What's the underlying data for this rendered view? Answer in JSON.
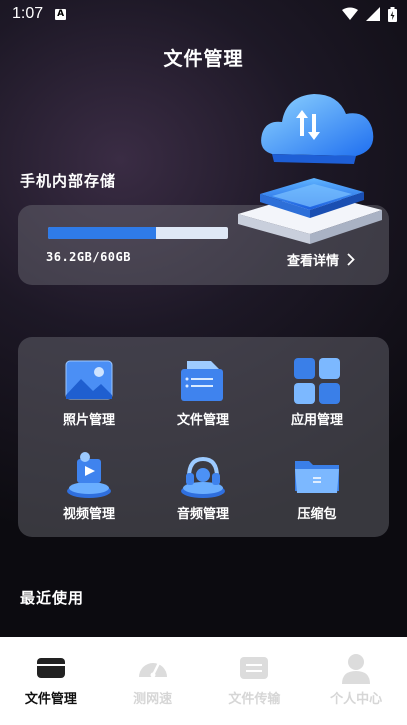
{
  "status": {
    "time": "1:07",
    "a_badge": "A"
  },
  "header": {
    "title": "文件管理"
  },
  "storage": {
    "label": "手机内部存储",
    "usage_text": "36.2GB/60GB",
    "used_fraction": 0.6,
    "details_label": "查看详情",
    "bar_color": "#2f7be8",
    "track_color": "#dfe8f6"
  },
  "tools": [
    {
      "label": "照片管理",
      "icon": "photo-icon"
    },
    {
      "label": "文件管理",
      "icon": "file-icon"
    },
    {
      "label": "应用管理",
      "icon": "apps-icon"
    },
    {
      "label": "视频管理",
      "icon": "video-icon"
    },
    {
      "label": "音频管理",
      "icon": "audio-icon"
    },
    {
      "label": "压缩包",
      "icon": "zip-folder-icon"
    }
  ],
  "recent": {
    "label": "最近使用"
  },
  "nav": [
    {
      "label": "文件管理",
      "icon": "folder-nav-icon",
      "active": true
    },
    {
      "label": "测网速",
      "icon": "speedometer-icon",
      "active": false
    },
    {
      "label": "文件传输",
      "icon": "transfer-icon",
      "active": false
    },
    {
      "label": "个人中心",
      "icon": "user-icon",
      "active": false
    }
  ]
}
